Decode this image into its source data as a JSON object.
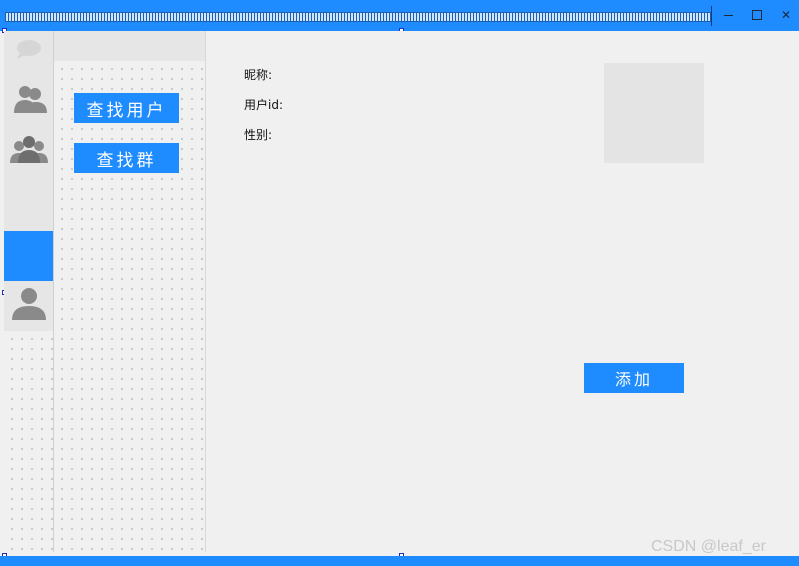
{
  "window": {
    "minimize_icon": "minimize-icon",
    "maximize_icon": "maximize-icon",
    "close_glyph": "✕"
  },
  "nav": {
    "items": [
      {
        "name": "chat",
        "icon": "chat-bubble-icon"
      },
      {
        "name": "contacts",
        "icon": "contacts-icon"
      },
      {
        "name": "groups",
        "icon": "group-icon"
      },
      {
        "name": "add",
        "icon": "blank-icon",
        "active": true
      },
      {
        "name": "profile",
        "icon": "user-icon"
      }
    ]
  },
  "panel": {
    "find_user_label": "查找用户",
    "find_group_label": "查找群"
  },
  "info": {
    "nickname_label": "昵称:",
    "user_id_label": "用户id:",
    "gender_label": "性别:",
    "add_label": "添加"
  },
  "watermark": "CSDN @leaf_er",
  "colors": {
    "accent": "#1e8cff",
    "rail_bg": "#e6e6e6",
    "content_bg": "#f0f0f0",
    "icon_gray": "#8a8a8a"
  }
}
